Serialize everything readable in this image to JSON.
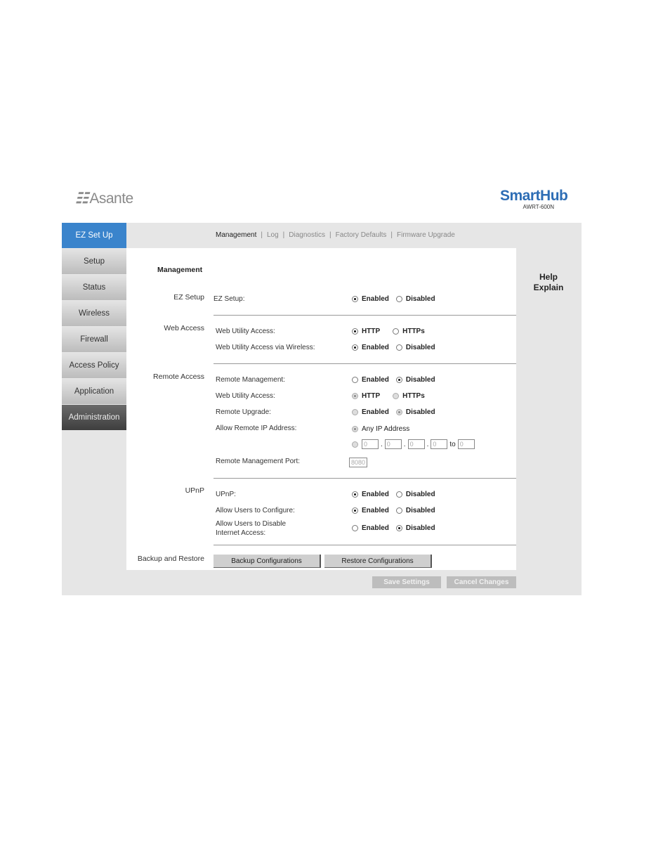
{
  "header": {
    "brand": "Asante",
    "brand_mark": "☷",
    "product": "SmartHub",
    "model": "AWRT-600N"
  },
  "sidebar": {
    "items": [
      {
        "label": "EZ Set Up",
        "state": "active"
      },
      {
        "label": "Setup"
      },
      {
        "label": "Status"
      },
      {
        "label": "Wireless"
      },
      {
        "label": "Firewall"
      },
      {
        "label": "Access Policy"
      },
      {
        "label": "Application"
      },
      {
        "label": "Administration",
        "state": "selected"
      }
    ]
  },
  "subnav": {
    "items": [
      "Management",
      "Log",
      "Diagnostics",
      "Factory Defaults",
      "Firmware Upgrade"
    ],
    "current": "Management"
  },
  "help": {
    "line1": "Help",
    "line2": "Explain"
  },
  "section_title": "Management",
  "groups": {
    "ez_setup": "EZ Setup",
    "web_access": "Web Access",
    "remote_access": "Remote Access",
    "upnp": "UPnP",
    "backup": "Backup and Restore"
  },
  "fields": {
    "ez_setup": {
      "label": "EZ Setup:",
      "options": [
        "Enabled",
        "Disabled"
      ],
      "selected": "Enabled"
    },
    "web_utility_access": {
      "label": "Web Utility Access:",
      "options": [
        "HTTP",
        "HTTPs"
      ],
      "selected": "HTTP"
    },
    "web_access_wireless": {
      "label": "Web Utility Access via Wireless:",
      "options": [
        "Enabled",
        "Disabled"
      ],
      "selected": "Enabled"
    },
    "remote_management": {
      "label": "Remote Management:",
      "options": [
        "Enabled",
        "Disabled"
      ],
      "selected": "Disabled"
    },
    "remote_web_access": {
      "label": "Web Utility Access:",
      "options": [
        "HTTP",
        "HTTPs"
      ],
      "selected": "HTTP",
      "disabled": true
    },
    "remote_upgrade": {
      "label": "Remote Upgrade:",
      "options": [
        "Enabled",
        "Disabled"
      ],
      "selected": "Disabled",
      "disabled": true
    },
    "allow_remote_ip": {
      "label": "Allow Remote IP Address:",
      "any_label": "Any IP Address",
      "selected": "Any IP Address",
      "ip": [
        "0",
        "0",
        "0",
        "0"
      ],
      "to_label": "to",
      "to_value": "0",
      "disabled": true
    },
    "remote_port": {
      "label": "Remote Management Port:",
      "value": "8080"
    },
    "upnp": {
      "label": "UPnP:",
      "options": [
        "Enabled",
        "Disabled"
      ],
      "selected": "Enabled"
    },
    "allow_configure": {
      "label": "Allow Users to Configure:",
      "options": [
        "Enabled",
        "Disabled"
      ],
      "selected": "Enabled"
    },
    "allow_disable_internet": {
      "label_line1": "Allow Users to Disable",
      "label_line2": "Internet Access:",
      "options": [
        "Enabled",
        "Disabled"
      ],
      "selected": "Disabled"
    }
  },
  "buttons": {
    "backup": "Backup Configurations",
    "restore": "Restore Configurations",
    "save": "Save Settings",
    "cancel": "Cancel Changes"
  }
}
